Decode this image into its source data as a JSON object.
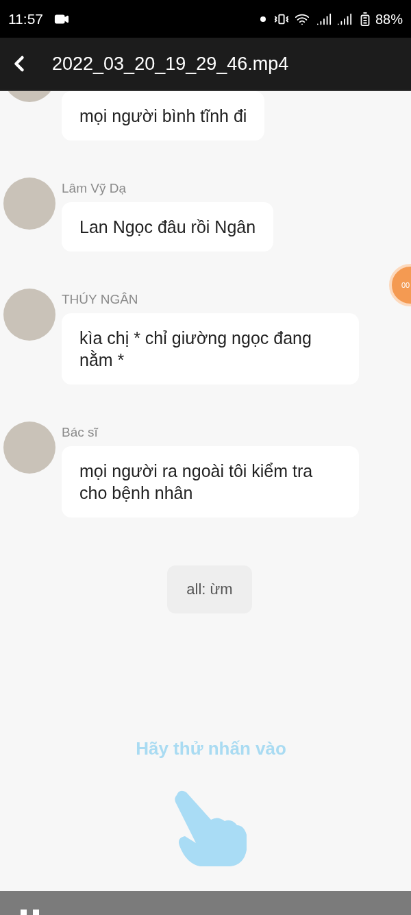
{
  "status_bar": {
    "time": "11:57",
    "battery": "88%"
  },
  "app_bar": {
    "title": "2022_03_20_19_29_46.mp4"
  },
  "messages": [
    {
      "kind": "partial",
      "text": "mọi người bình tĩnh đi"
    },
    {
      "kind": "chat",
      "name": "Lâm Vỹ Dạ",
      "text": "Lan Ngọc đâu rồi Ngân"
    },
    {
      "kind": "chat",
      "name": "THÚY NGÂN",
      "text": "kìa chị * chỉ giường ngọc đang nằm *"
    },
    {
      "kind": "chat",
      "name": "Bác sĩ",
      "text": "mọi người ra ngoài tôi kiểm tra cho bệnh nhân"
    },
    {
      "kind": "system",
      "text": "all: ừm"
    }
  ],
  "floating_button": {
    "text": "00"
  },
  "hint": "Hãy thử nhấn vào"
}
